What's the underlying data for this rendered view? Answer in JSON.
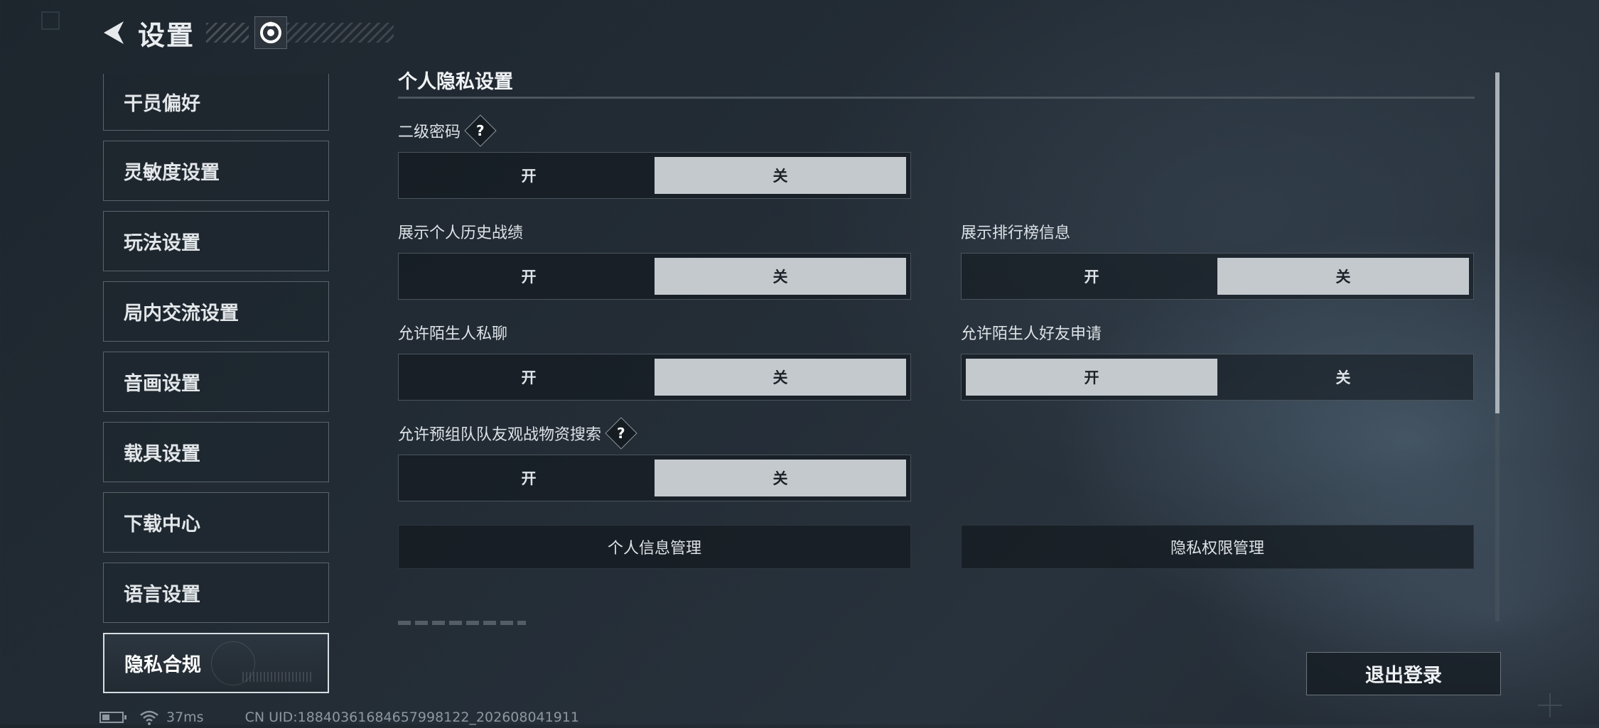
{
  "header": {
    "title": "设置"
  },
  "sidebar": {
    "items": [
      {
        "label": "干员偏好"
      },
      {
        "label": "灵敏度设置"
      },
      {
        "label": "玩法设置"
      },
      {
        "label": "局内交流设置"
      },
      {
        "label": "音画设置"
      },
      {
        "label": "载具设置"
      },
      {
        "label": "下载中心"
      },
      {
        "label": "语言设置"
      },
      {
        "label": "隐私合规",
        "active": true
      }
    ]
  },
  "content": {
    "section_title": "个人隐私设置",
    "settings": [
      {
        "label": "二级密码",
        "on_label": "开",
        "off_label": "关",
        "selected": "关",
        "help": "?"
      },
      {
        "label": "展示个人历史战绩",
        "on_label": "开",
        "off_label": "关",
        "selected": "关"
      },
      {
        "label": "展示排行榜信息",
        "on_label": "开",
        "off_label": "关",
        "selected": "关"
      },
      {
        "label": "允许陌生人私聊",
        "on_label": "开",
        "off_label": "关",
        "selected": "关"
      },
      {
        "label": "允许陌生人好友申请",
        "on_label": "开",
        "off_label": "关",
        "selected": "开"
      },
      {
        "label": "允许预组队队友观战物资搜索",
        "on_label": "开",
        "off_label": "关",
        "selected": "关",
        "help": "?"
      }
    ],
    "buttons": {
      "personal_info": "个人信息管理",
      "privacy_permissions": "隐私权限管理"
    }
  },
  "logout_label": "退出登录",
  "status_bar": {
    "ping": "37ms",
    "uid": "CN UID:18840361684657998122_202608041911"
  },
  "icons": [
    "back-arrow-icon",
    "logo-icon",
    "help-icon",
    "battery-icon",
    "wifi-icon"
  ],
  "colors": {
    "selected_option": "#c4c9ce",
    "background": "#222a33"
  }
}
